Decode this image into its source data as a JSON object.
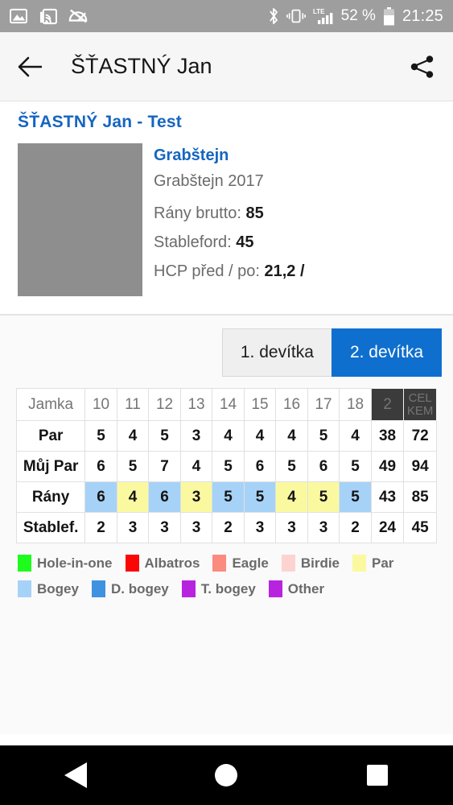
{
  "statusbar": {
    "icons_left": [
      "image-icon",
      "rss-cast-icon",
      "mute-icon"
    ],
    "icons_right": [
      "bluetooth-icon",
      "vibrate-icon",
      "lte-signal-icon"
    ],
    "lte_label": "LTE",
    "battery_percent": "52 %",
    "time": "21:25"
  },
  "appbar": {
    "back_icon": "back-arrow-icon",
    "title": "ŠŤASTNÝ Jan",
    "share_icon": "share-icon"
  },
  "card": {
    "title": "ŠŤASTNÝ Jan - Test",
    "course": "Grabštejn",
    "event": "Grabštejn 2017",
    "stats": [
      {
        "label": "Rány brutto:",
        "value": "85"
      },
      {
        "label": "Stableford:",
        "value": "45"
      },
      {
        "label": "HCP před / po:",
        "value": "21,2 /"
      }
    ]
  },
  "tabs": [
    {
      "label": "1. devítka",
      "active": false
    },
    {
      "label": "2. devítka",
      "active": true
    }
  ],
  "scorecard": {
    "row_labels": [
      "Jamka",
      "Par",
      "Můj Par",
      "Rány",
      "Stablef."
    ],
    "holes": [
      "10",
      "11",
      "12",
      "13",
      "14",
      "15",
      "16",
      "17",
      "18"
    ],
    "total_headers": [
      "2",
      "CEL\nKEM"
    ],
    "total_header_1": "2",
    "total_header_2_line1": "CEL",
    "total_header_2_line2": "KEM",
    "rows": [
      {
        "label": "Par",
        "values": [
          "5",
          "4",
          "5",
          "3",
          "4",
          "4",
          "4",
          "5",
          "4"
        ],
        "totals": [
          "38",
          "72"
        ],
        "colors": [
          "",
          "",
          "",
          "",
          "",
          "",
          "",
          "",
          ""
        ]
      },
      {
        "label": "Můj Par",
        "values": [
          "6",
          "5",
          "7",
          "4",
          "5",
          "6",
          "5",
          "6",
          "5"
        ],
        "totals": [
          "49",
          "94"
        ],
        "colors": [
          "",
          "",
          "",
          "",
          "",
          "",
          "",
          "",
          ""
        ]
      },
      {
        "label": "Rány",
        "values": [
          "6",
          "4",
          "6",
          "3",
          "5",
          "5",
          "4",
          "5",
          "5"
        ],
        "totals": [
          "43",
          "85"
        ],
        "colors": [
          "#a6d2f7",
          "#faf9a0",
          "#a6d2f7",
          "#faf9a0",
          "#a6d2f7",
          "#a6d2f7",
          "#faf9a0",
          "#faf9a0",
          "#a6d2f7"
        ]
      },
      {
        "label": "Stablef.",
        "values": [
          "2",
          "3",
          "3",
          "3",
          "2",
          "3",
          "3",
          "3",
          "2"
        ],
        "totals": [
          "24",
          "45"
        ],
        "colors": [
          "",
          "",
          "",
          "",
          "",
          "",
          "",
          "",
          ""
        ]
      }
    ]
  },
  "legend": {
    "row1": [
      {
        "label": "Hole-in-one",
        "color": "#1dfc1d"
      },
      {
        "label": "Albatros",
        "color": "#fb0606"
      },
      {
        "label": "Eagle",
        "color": "#fb8a7f"
      },
      {
        "label": "Birdie",
        "color": "#fcd3d0"
      },
      {
        "label": "Par",
        "color": "#faf9a0"
      }
    ],
    "row2": [
      {
        "label": "Bogey",
        "color": "#a6d2f7"
      },
      {
        "label": "D. bogey",
        "color": "#3f92e0"
      },
      {
        "label": "T. bogey",
        "color": "#b823e0"
      },
      {
        "label": "Other",
        "color": "#b823e0"
      }
    ]
  },
  "navbar": {
    "back": "nav-back-icon",
    "home": "nav-home-icon",
    "recents": "nav-recents-icon"
  }
}
